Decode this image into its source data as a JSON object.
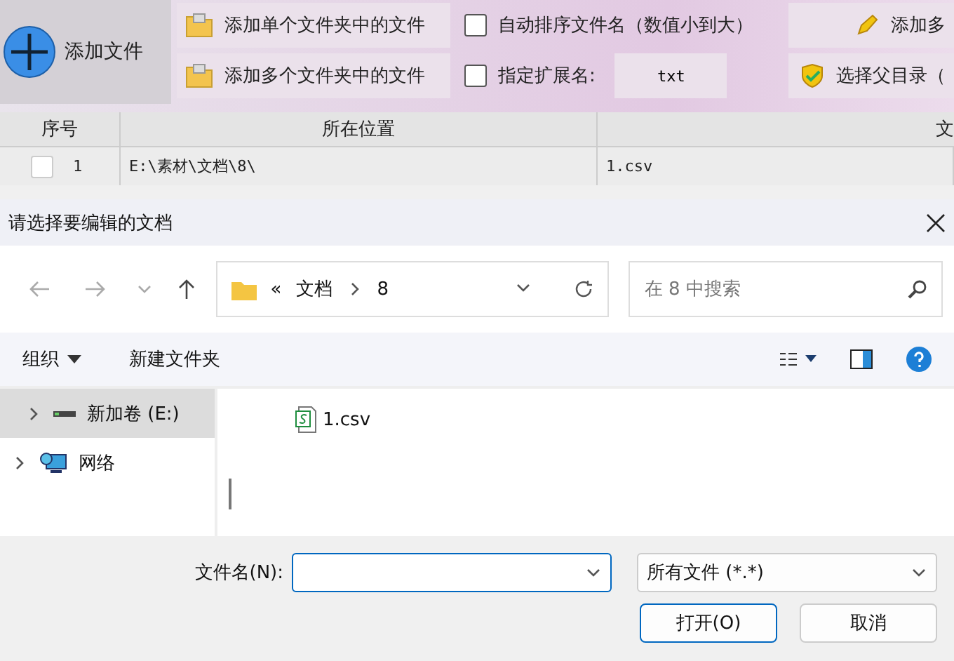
{
  "toolbar": {
    "main_button": "添加文件",
    "buttons": [
      {
        "label": "添加单个文件夹中的文件",
        "kind": "folder"
      },
      {
        "label": "添加多个文件夹中的文件",
        "kind": "folder"
      }
    ],
    "options": [
      {
        "label": "自动排序文件名（数值小到大）",
        "checked": false
      },
      {
        "label": "指定扩展名:",
        "checked": false,
        "value": "txt"
      }
    ],
    "right_buttons": [
      {
        "label": "添加多",
        "kind": "pencil"
      },
      {
        "label": "选择父目录（",
        "kind": "shield"
      }
    ]
  },
  "table": {
    "columns": [
      "序号",
      "所在位置",
      "文"
    ],
    "rows": [
      {
        "index": "1",
        "checked": false,
        "location": "E:\\素材\\文档\\8\\",
        "file": "1.csv"
      }
    ]
  },
  "dialog": {
    "title": "请选择要编辑的文档",
    "path": [
      "«",
      "文档",
      "8"
    ],
    "search": {
      "placeholder": "在 8 中搜索"
    },
    "commands": [
      "组织",
      "新建文件夹"
    ],
    "tree": [
      {
        "label": "新加卷 (E:)",
        "kind": "drive",
        "selected": true
      },
      {
        "label": "网络",
        "kind": "network",
        "selected": false
      }
    ],
    "files": [
      {
        "name": "1.csv"
      }
    ],
    "filename_label": "文件名(N):",
    "filetype": "所有文件 (*.*)",
    "buttons": [
      {
        "label": "打开(O)",
        "primary": true
      },
      {
        "label": "取消",
        "primary": false
      }
    ]
  }
}
